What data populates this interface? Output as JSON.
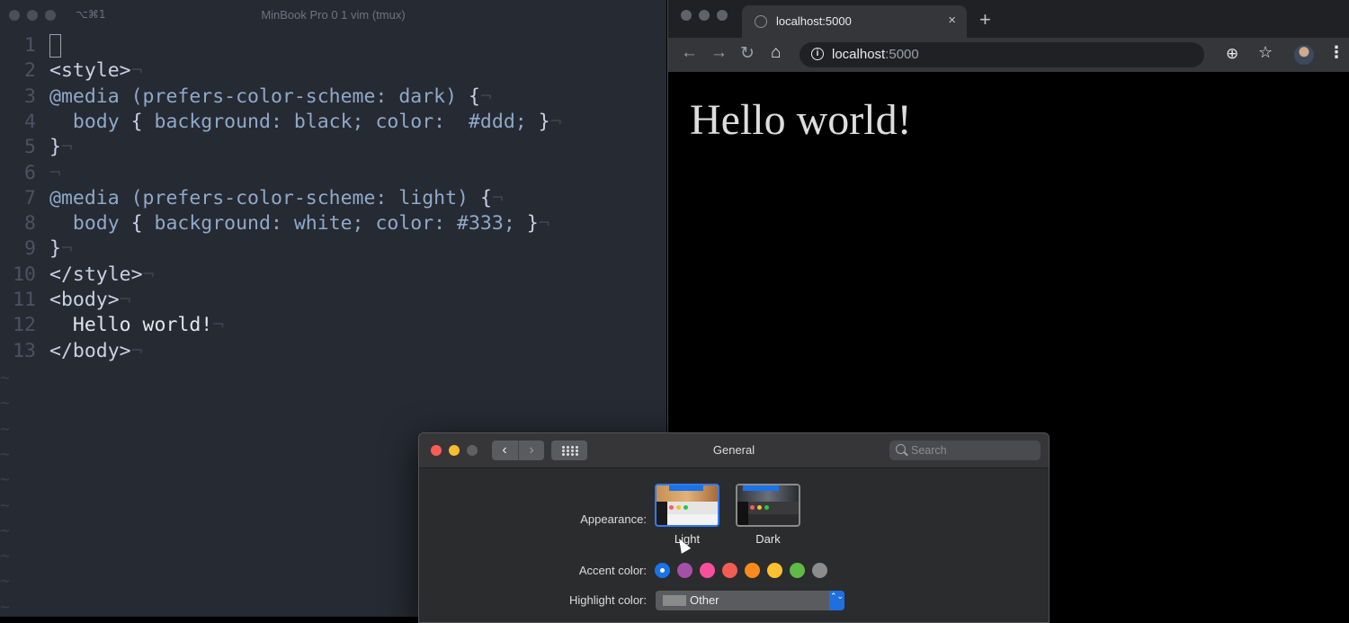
{
  "terminal": {
    "shortcut": "⌥⌘1",
    "title": "MinBook Pro 0 1 vim (tmux)",
    "lines": [
      {
        "n": "1",
        "parts": [
          {
            "cls": "cursor",
            "t": ""
          }
        ]
      },
      {
        "n": "2",
        "parts": [
          {
            "cls": "tag",
            "t": "<style>"
          },
          {
            "cls": "eol",
            "t": "¬"
          }
        ]
      },
      {
        "n": "3",
        "parts": [
          {
            "cls": "kw",
            "t": "@media (prefers-color-scheme: dark) "
          },
          {
            "cls": "tag",
            "t": "{"
          },
          {
            "cls": "eol",
            "t": "¬"
          }
        ]
      },
      {
        "n": "4",
        "parts": [
          {
            "cls": "kw",
            "t": "  body "
          },
          {
            "cls": "tag",
            "t": "{ "
          },
          {
            "cls": "kw",
            "t": "background: black; color:  #ddd; "
          },
          {
            "cls": "tag",
            "t": "}"
          },
          {
            "cls": "eol",
            "t": "¬"
          }
        ]
      },
      {
        "n": "5",
        "parts": [
          {
            "cls": "tag",
            "t": "}"
          },
          {
            "cls": "eol",
            "t": "¬"
          }
        ]
      },
      {
        "n": "6",
        "parts": [
          {
            "cls": "eol",
            "t": "¬"
          }
        ]
      },
      {
        "n": "7",
        "parts": [
          {
            "cls": "kw",
            "t": "@media (prefers-color-scheme: light) "
          },
          {
            "cls": "tag",
            "t": "{"
          },
          {
            "cls": "eol",
            "t": "¬"
          }
        ]
      },
      {
        "n": "8",
        "parts": [
          {
            "cls": "kw",
            "t": "  body "
          },
          {
            "cls": "tag",
            "t": "{ "
          },
          {
            "cls": "kw",
            "t": "background: white; color: #333; "
          },
          {
            "cls": "tag",
            "t": "}"
          },
          {
            "cls": "eol",
            "t": "¬"
          }
        ]
      },
      {
        "n": "9",
        "parts": [
          {
            "cls": "tag",
            "t": "}"
          },
          {
            "cls": "eol",
            "t": "¬"
          }
        ]
      },
      {
        "n": "10",
        "parts": [
          {
            "cls": "tag",
            "t": "</style>"
          },
          {
            "cls": "eol",
            "t": "¬"
          }
        ]
      },
      {
        "n": "11",
        "parts": [
          {
            "cls": "tag",
            "t": "<body>"
          },
          {
            "cls": "eol",
            "t": "¬"
          }
        ]
      },
      {
        "n": "12",
        "parts": [
          {
            "cls": "",
            "t": "  Hello world!"
          },
          {
            "cls": "eol",
            "t": "¬"
          }
        ]
      },
      {
        "n": "13",
        "parts": [
          {
            "cls": "tag",
            "t": "</body>"
          },
          {
            "cls": "eol",
            "t": "¬"
          }
        ]
      }
    ],
    "tilde": "~"
  },
  "browser": {
    "tab_title": "localhost:5000",
    "tab_close": "×",
    "new_tab": "+",
    "url_host": "localhost",
    "url_port": ":5000",
    "back": "←",
    "forward": "→",
    "reload": "↻",
    "home": "⌂",
    "zoom": "⊕",
    "star": "☆",
    "menu": "⋮",
    "info": "i",
    "page_text": "Hello world!"
  },
  "prefs": {
    "title": "General",
    "search_placeholder": "Search",
    "back": "‹",
    "forward": "›",
    "appearance_label": "Appearance:",
    "appearance_options": [
      {
        "label": "Light",
        "selected": true
      },
      {
        "label": "Dark",
        "selected": false
      }
    ],
    "accent_label": "Accent color:",
    "accent_colors": [
      "#1a73e8",
      "#a550a7",
      "#f74f9e",
      "#f25c54",
      "#fc8a1a",
      "#fdc02f",
      "#5fba46",
      "#8c8c8c"
    ],
    "accent_selected_index": 0,
    "highlight_label": "Highlight color:",
    "highlight_value": "Other",
    "highlight_arrows": "⌃⌄"
  },
  "colors": {
    "terminal_bg": "#262a33",
    "browser_bg": "#000000",
    "page_text": "#dddddd",
    "accent": "#1a73e8"
  }
}
